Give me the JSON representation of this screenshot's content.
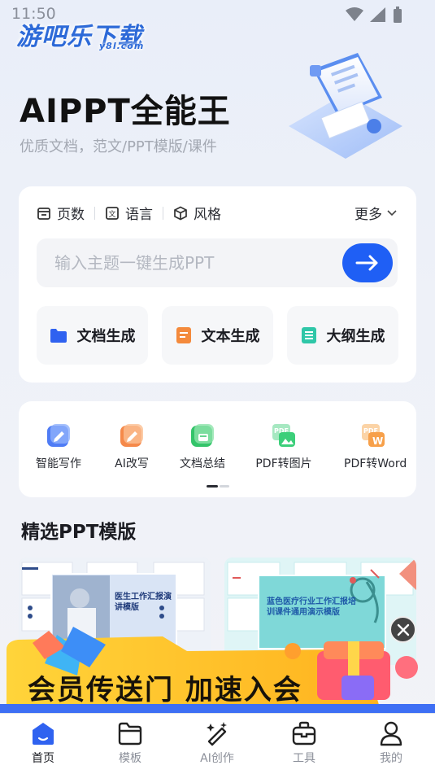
{
  "status_bar": {
    "time": "11:50"
  },
  "watermark": {
    "main": "游吧乐下载",
    "sub": "y8l.com"
  },
  "hero": {
    "title": "AIPPT全能王",
    "subtitle": "优质文档，范文/PPT模版/课件"
  },
  "generator": {
    "options": [
      {
        "label": "页数",
        "icon": "pages-icon"
      },
      {
        "label": "语言",
        "icon": "language-icon"
      },
      {
        "label": "风格",
        "icon": "style-cube-icon"
      }
    ],
    "more_label": "更多",
    "input_placeholder": "输入主题一键生成PPT",
    "buttons": [
      {
        "label": "文档生成",
        "icon": "folder-icon",
        "color": "#2f62f0"
      },
      {
        "label": "文本生成",
        "icon": "text-doc-icon",
        "color": "#f48a3c"
      },
      {
        "label": "大纲生成",
        "icon": "outline-icon",
        "color": "#2fc7a8"
      }
    ],
    "accent": "#1f5ff5"
  },
  "tools": [
    {
      "label": "智能写作",
      "icon": "pen-write-icon",
      "color": "#4f7cf5"
    },
    {
      "label": "AI改写",
      "icon": "rewrite-icon",
      "color": "#f5894a"
    },
    {
      "label": "文档总结",
      "icon": "summary-icon",
      "color": "#34c46a"
    },
    {
      "label": "PDF转图片",
      "icon": "pdf-to-image-icon",
      "color": "#3ccf7a"
    },
    {
      "label": "PDF转Word",
      "icon": "pdf-to-word-icon",
      "color": "#f7a04a"
    }
  ],
  "section": {
    "title": "精选PPT模版"
  },
  "templates": [
    {
      "title": "医生工作汇报演讲模版"
    },
    {
      "title": "蓝色医疗行业工作汇报培训课件通用演示模版"
    }
  ],
  "promo": {
    "text": "会员传送门 加速入会"
  },
  "tabbar": {
    "tabs": [
      {
        "label": "首页",
        "icon": "home-icon",
        "active": true
      },
      {
        "label": "模板",
        "icon": "template-folder-icon",
        "active": false
      },
      {
        "label": "AI创作",
        "icon": "ai-magic-wand-icon",
        "active": false
      },
      {
        "label": "工具",
        "icon": "toolbox-icon",
        "active": false
      },
      {
        "label": "我的",
        "icon": "profile-icon",
        "active": false
      }
    ]
  }
}
